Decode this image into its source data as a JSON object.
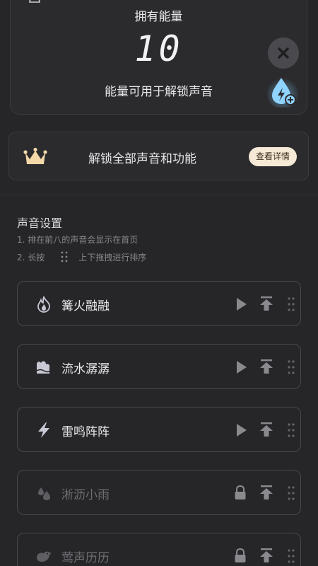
{
  "energy": {
    "title": "拥有能量",
    "value": "10",
    "description": "能量可用于解锁声音"
  },
  "vip": {
    "text": "解锁全部声音和功能",
    "detail_button": "查看详情"
  },
  "settings": {
    "title": "声音设置",
    "hint1": "1. 排在前八的声音会显示在首页",
    "hint2_prefix": "2. 长按",
    "hint2_suffix": "上下拖拽进行排序"
  },
  "sounds": [
    {
      "name": "篝火融融",
      "icon": "fire-icon",
      "locked": false
    },
    {
      "name": "流水潺潺",
      "icon": "water-icon",
      "locked": false
    },
    {
      "name": "雷鸣阵阵",
      "icon": "lightning-icon",
      "locked": false
    },
    {
      "name": "淅沥小雨",
      "icon": "rain-icon",
      "locked": true
    },
    {
      "name": "莺声历历",
      "icon": "bird-icon",
      "locked": true
    }
  ],
  "colors": {
    "background": "#262629",
    "card": "#2b2b2e",
    "accent_blue": "#5fb8f0",
    "detail_button_bg": "#f6ead6",
    "crown": "#f3d9a8"
  }
}
